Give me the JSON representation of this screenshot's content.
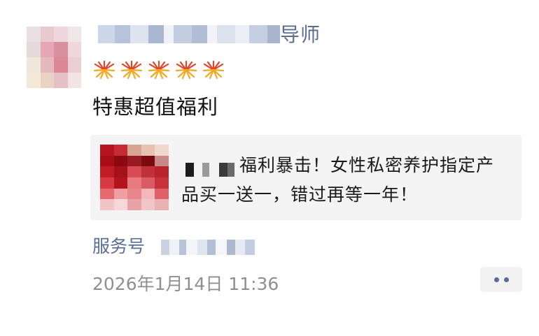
{
  "post": {
    "author_suffix": "导师",
    "emoji_icon": "fireworks-icon",
    "text": "特惠超值福利",
    "card": {
      "title_line1": "福利暴击！女性私密养护指定产",
      "title_line2": "品买一送一，错过再等一年！"
    },
    "source_label": "服务号",
    "timestamp": "2026年1月14日 11:36",
    "more_icon": "more-dots-icon"
  },
  "colors": {
    "link": "#5a6d93",
    "text": "#111111",
    "meta": "#8f8f8f",
    "card_bg": "#f4f4f4"
  }
}
